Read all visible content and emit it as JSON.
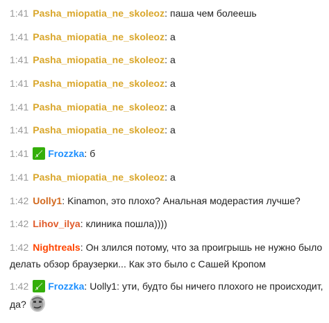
{
  "colors": {
    "pasha": "#d9a62a",
    "frozzka": "#1e90ff",
    "uolly": "#d2691e",
    "lihov": "#e05a2a",
    "nightreals": "#ff4500",
    "moderator_badge": "#34ae0a"
  },
  "icons": {
    "moderator_badge": "moderator-sword-icon",
    "emote": "kappa-face-emote"
  },
  "messages": [
    {
      "time": "1:41",
      "user": "Pasha_miopatia_ne_skoleoz",
      "text": "паша чем болеешь"
    },
    {
      "time": "1:41",
      "user": "Pasha_miopatia_ne_skoleoz",
      "text": "а"
    },
    {
      "time": "1:41",
      "user": "Pasha_miopatia_ne_skoleoz",
      "text": "а"
    },
    {
      "time": "1:41",
      "user": "Pasha_miopatia_ne_skoleoz",
      "text": "а"
    },
    {
      "time": "1:41",
      "user": "Pasha_miopatia_ne_skoleoz",
      "text": "а"
    },
    {
      "time": "1:41",
      "user": "Pasha_miopatia_ne_skoleoz",
      "text": "а"
    },
    {
      "time": "1:41",
      "user": "Frozzka",
      "text": "б"
    },
    {
      "time": "1:41",
      "user": "Pasha_miopatia_ne_skoleoz",
      "text": "а"
    },
    {
      "time": "1:42",
      "user": "Uolly1",
      "text": "Kinamon, это плохо? Анальная модерастия лучше?"
    },
    {
      "time": "1:42",
      "user": "Lihov_ilya",
      "text": "клиника пошла))))"
    },
    {
      "time": "1:42",
      "user": "Nightreals",
      "text": "Он злился потому, что за проигрышь не нужно было делать обзор браузерки... Как это было с Сашей Кропом"
    },
    {
      "time": "1:42",
      "user": "Frozzka",
      "text": "Uolly1: ути, будто бы ничего плохого не происходит, да?"
    }
  ]
}
